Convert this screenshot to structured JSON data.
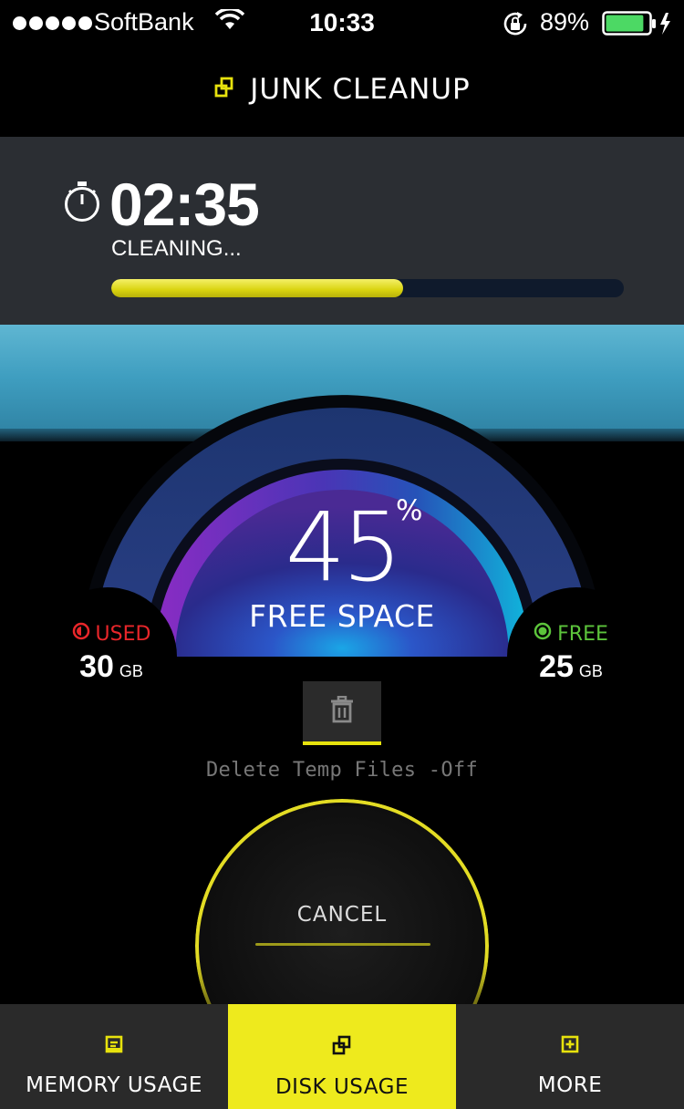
{
  "status_bar": {
    "carrier": "SoftBank",
    "time": "10:33",
    "battery_percent": "89%",
    "battery_level": 0.89
  },
  "header": {
    "title": "JUNK CLEANUP",
    "icon": "disk-icon"
  },
  "timer": {
    "value": "02:35",
    "status": "CLEANING...",
    "progress": 0.57
  },
  "gauge": {
    "percent": "45",
    "percent_symbol": "%",
    "label": "FREE SPACE",
    "free_fraction": 0.45
  },
  "used": {
    "label": "USED",
    "value": "30",
    "unit": "GB",
    "color": "#e8262a"
  },
  "free": {
    "label": "FREE",
    "value": "25",
    "unit": "GB",
    "color": "#5cc43b"
  },
  "delete_temp": {
    "label": "Delete Temp Files -Off",
    "icon": "trash-icon"
  },
  "cancel": {
    "label": "CANCEL"
  },
  "tabs": [
    {
      "label": "MEMORY USAGE",
      "icon": "memory-icon",
      "active": false
    },
    {
      "label": "DISK USAGE",
      "icon": "disk-icon",
      "active": true
    },
    {
      "label": "MORE",
      "icon": "more-icon",
      "active": false
    }
  ],
  "colors": {
    "accent": "#eeea1d",
    "panel": "#2b2e33",
    "tabbar": "#2a2a2a"
  }
}
